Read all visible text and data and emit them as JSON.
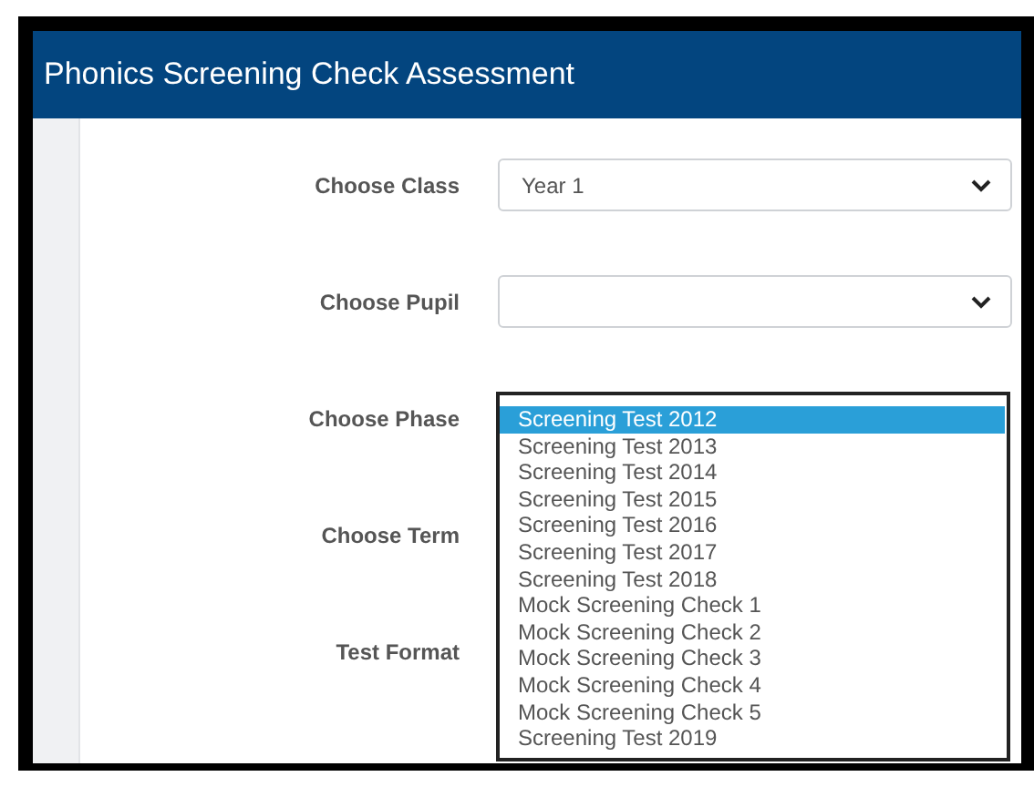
{
  "window": {
    "title": "Phonics Screening Check Assessment"
  },
  "fields": [
    {
      "label": "Choose Class",
      "kind": "select",
      "value": "Year 1"
    },
    {
      "label": "Choose Pupil",
      "kind": "select"
    },
    {
      "label": "Choose Phase",
      "kind": "covered"
    },
    {
      "label": "Choose Term",
      "kind": "covered"
    },
    {
      "label": "Test Format",
      "kind": "covered"
    }
  ],
  "dropdown": {
    "options": [
      {
        "label": "Screening Test 2012",
        "selected": true
      },
      {
        "label": "Screening Test 2013",
        "selected": false
      },
      {
        "label": "Screening Test 2014",
        "selected": false
      },
      {
        "label": "Screening Test 2015",
        "selected": false
      },
      {
        "label": "Screening Test 2016",
        "selected": false
      },
      {
        "label": "Screening Test 2017",
        "selected": false
      },
      {
        "label": "Screening Test 2018",
        "selected": false
      },
      {
        "label": "Mock Screening Check 1",
        "selected": false
      },
      {
        "label": "Mock Screening Check 2",
        "selected": false
      },
      {
        "label": "Mock Screening Check 3",
        "selected": false
      },
      {
        "label": "Mock Screening Check 4",
        "selected": false
      },
      {
        "label": "Mock Screening Check 5",
        "selected": false
      },
      {
        "label": "Screening Test 2019",
        "selected": false
      }
    ]
  }
}
